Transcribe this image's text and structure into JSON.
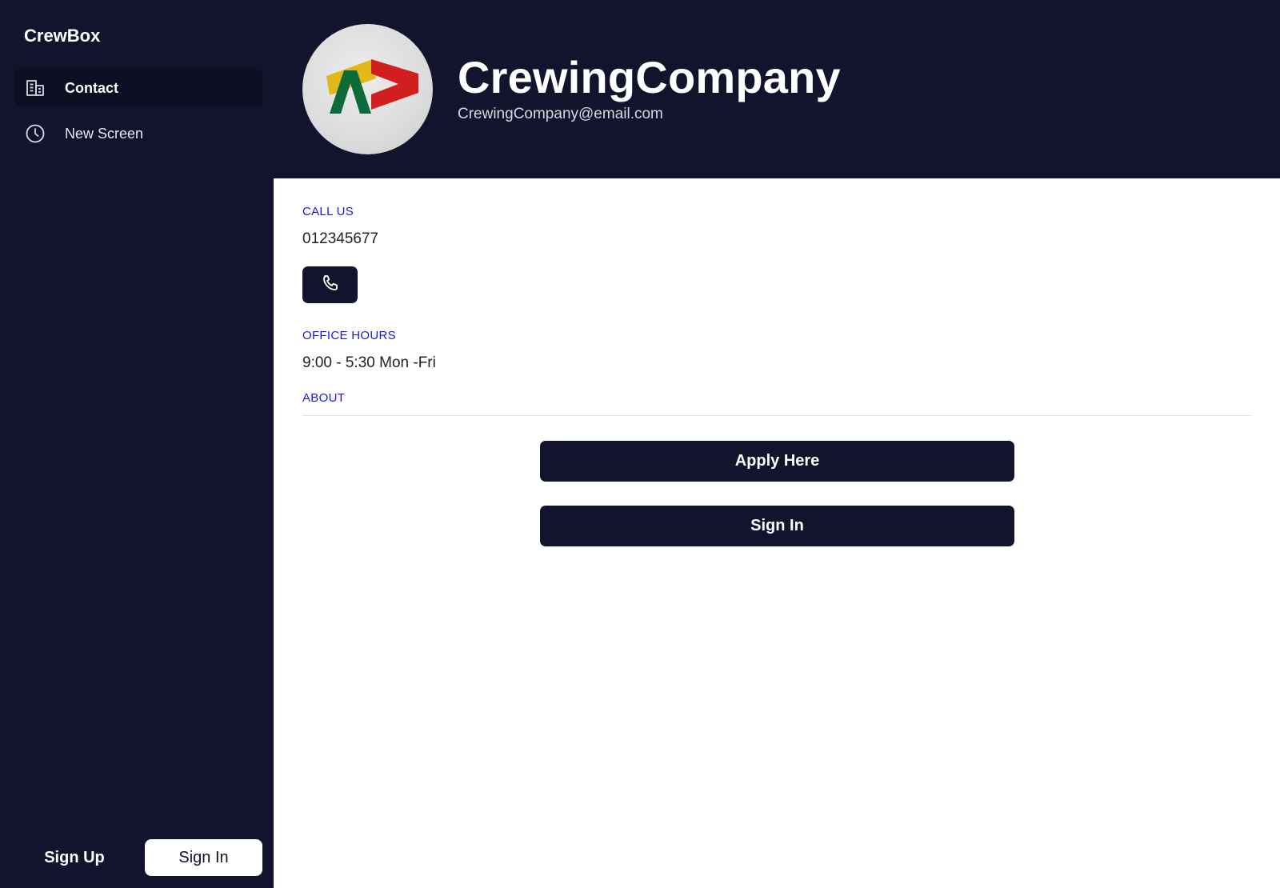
{
  "sidebar": {
    "brand": "CrewBox",
    "items": [
      {
        "label": "Contact",
        "icon": "building-icon",
        "active": true
      },
      {
        "label": "New Screen",
        "icon": "clock-icon",
        "active": false
      }
    ],
    "sign_up_label": "Sign Up",
    "sign_in_label": "Sign In"
  },
  "header": {
    "company_name": "CrewingCompany",
    "email": "CrewingCompany@email.com",
    "avatar_icon": "company-logo"
  },
  "contact": {
    "call_us_label": "CALL US",
    "phone": "012345677",
    "call_button_icon": "phone-icon",
    "office_hours_label": "OFFICE HOURS",
    "office_hours": "9:00 - 5:30 Mon -Fri",
    "about_label": "ABOUT"
  },
  "actions": {
    "apply_label": "Apply Here",
    "sign_in_label": "Sign In"
  },
  "colors": {
    "navy": "#12142d",
    "accent_label": "#1a1ad6",
    "white": "#ffffff"
  }
}
